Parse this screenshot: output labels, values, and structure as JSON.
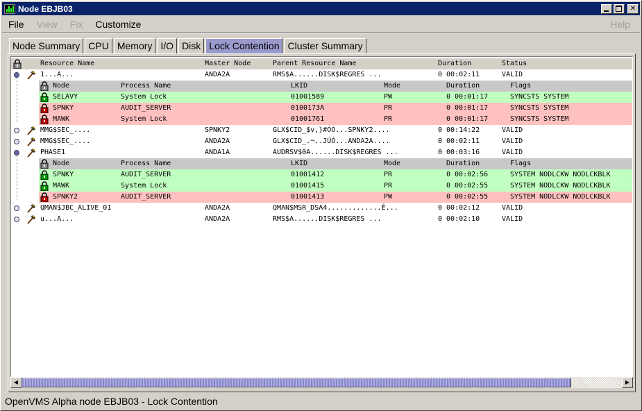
{
  "window": {
    "title": "Node EBJB03"
  },
  "menu": {
    "file": "File",
    "view": "View",
    "fix": "Fix",
    "customize": "Customize",
    "help": "Help"
  },
  "tabs": [
    "Node Summary",
    "CPU",
    "Memory",
    "I/O",
    "Disk",
    "Lock Contention",
    "Cluster Summary"
  ],
  "active_tab": "Lock Contention",
  "columns": {
    "resource": "Resource Name",
    "master": "Master Node",
    "parent": "Parent Resource Name",
    "duration": "Duration",
    "status": "Status"
  },
  "subcolumns": {
    "node": "Node",
    "process": "Process Name",
    "lkid": "LKID",
    "mode": "Mode",
    "duration": "Duration",
    "flags": "Flags"
  },
  "resources": [
    {
      "name": "1...A...",
      "master": "ANDA2A",
      "parent": "RMS$A......DISK$REGRES ...",
      "duration": "0 00:02:11",
      "status": "VALID",
      "expanded": true,
      "locks": [
        {
          "node": "SELAVY",
          "process": "System Lock",
          "lkid": "01001589",
          "mode": "PW",
          "duration": "0 00:01:17",
          "flags": "SYNCSTS SYSTEM",
          "state": "granted"
        },
        {
          "node": "SPNKY",
          "process": "AUDIT_SERVER",
          "lkid": "0100173A",
          "mode": "PR",
          "duration": "0 00:01:17",
          "flags": "SYNCSTS SYSTEM",
          "state": "waiting"
        },
        {
          "node": "MAWK",
          "process": "System Lock",
          "lkid": "01001761",
          "mode": "PR",
          "duration": "0 00:01:17",
          "flags": "SYNCSTS SYSTEM",
          "state": "waiting"
        }
      ]
    },
    {
      "name": "MMG$SEC_....",
      "master": "SPNKY2",
      "parent": "GLX$CID_$v,}#ÓÓ...SPNKY2....",
      "duration": "0 00:14:22",
      "status": "VALID",
      "expanded": false,
      "locks": []
    },
    {
      "name": "MMG$SEC_....",
      "master": "ANDA2A",
      "parent": "GLX$CID_.¬..JÚÓ...ANDA2A....",
      "duration": "0 00:02:11",
      "status": "VALID",
      "expanded": false,
      "locks": []
    },
    {
      "name": "PHASE1",
      "master": "ANDA1A",
      "parent": "AUDRSV$0A......DISK$REGRES ...",
      "duration": "0 00:03:16",
      "status": "VALID",
      "expanded": true,
      "locks": [
        {
          "node": "SPNKY",
          "process": "AUDIT_SERVER",
          "lkid": "01001412",
          "mode": "PR",
          "duration": "0 00:02:56",
          "flags": "SYSTEM NODLCKW NODLCKBLK",
          "state": "granted"
        },
        {
          "node": "MAWK",
          "process": "System Lock",
          "lkid": "01001415",
          "mode": "PR",
          "duration": "0 00:02:55",
          "flags": "SYSTEM NODLCKW NODLCKBLK",
          "state": "granted"
        },
        {
          "node": "SPNKY2",
          "process": "AUDIT_SERVER",
          "lkid": "01001413",
          "mode": "PW",
          "duration": "0 00:02:55",
          "flags": "SYSTEM NODLCKW NODLCKBLK",
          "state": "waiting"
        }
      ]
    },
    {
      "name": "QMAN$JBC_ALIVE_01",
      "master": "ANDA2A",
      "parent": "QMAN$MSR_DSA4.............É...",
      "duration": "0 00:02:12",
      "status": "VALID",
      "expanded": false,
      "locks": []
    },
    {
      "name": "u...A...",
      "master": "ANDA2A",
      "parent": "RMS$A......DISK$REGRES ...",
      "duration": "0 00:02:10",
      "status": "VALID",
      "expanded": false,
      "locks": []
    }
  ],
  "status_bar": "OpenVMS Alpha node EBJB03 - Lock Contention",
  "colors": {
    "granted": "#c0ffc0",
    "waiting": "#ffc0c0",
    "active_tab": "#9999cc",
    "titlebar": "#0a246a"
  }
}
